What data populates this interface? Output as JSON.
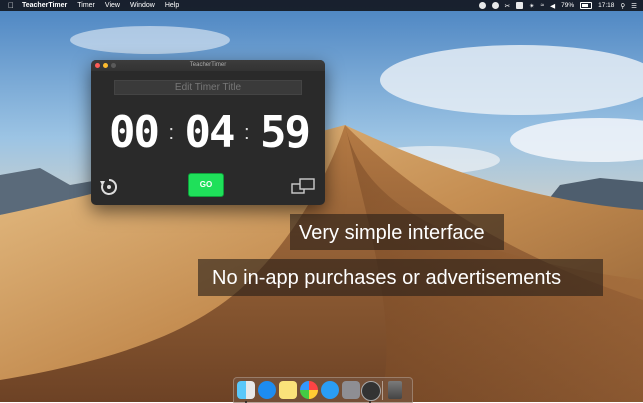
{
  "menubar": {
    "app_name": "TeacherTimer",
    "menus": [
      "Timer",
      "View",
      "Window",
      "Help"
    ],
    "battery_text": "79%",
    "clock": "17:18",
    "status_icons": [
      "sync-icon",
      "stop-icon",
      "scissors-icon",
      "key-icon",
      "bluetooth-icon",
      "wifi-icon",
      "volume-icon",
      "battery-icon",
      "search-icon",
      "list-icon"
    ]
  },
  "window": {
    "title": "TeacherTimer",
    "title_placeholder": "Edit Timer Title",
    "time": {
      "hours": "00",
      "minutes": "04",
      "seconds": "59"
    },
    "go_label": "GO"
  },
  "captions": {
    "line1": "Very simple interface",
    "line2": "No in-app purchases or advertisements"
  },
  "dock": {
    "apps": [
      "finder",
      "app-store",
      "notes",
      "photos",
      "safari",
      "system-preferences",
      "teachertimer",
      "trash"
    ]
  }
}
